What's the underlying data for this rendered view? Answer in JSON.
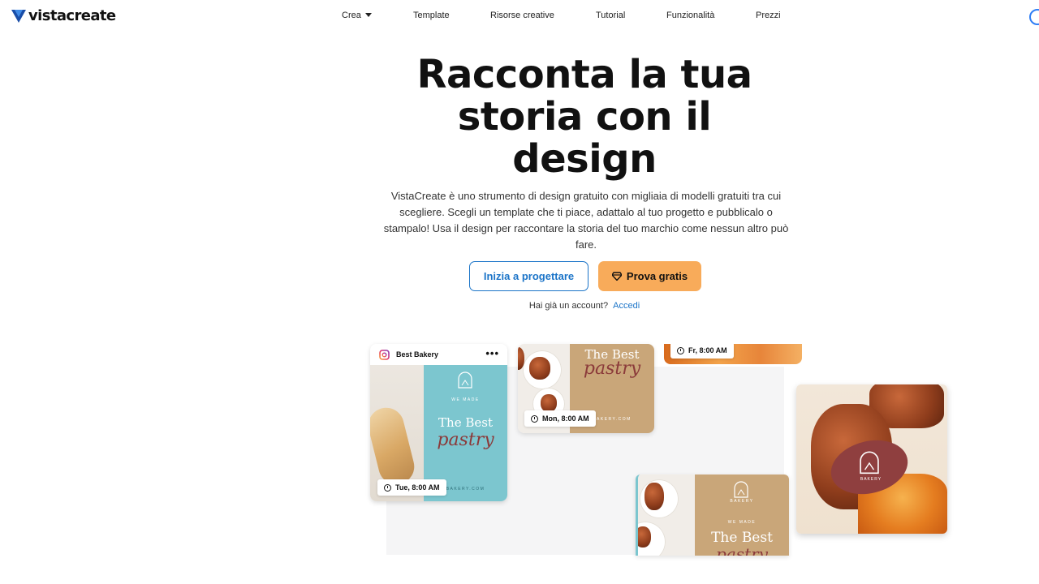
{
  "brand": {
    "name": "vistacreate",
    "colors": {
      "primary": "#1b74c8",
      "cta": "#f8ab5a",
      "logo": "#1a4ea8"
    }
  },
  "nav": {
    "items": [
      {
        "label": "Crea",
        "has_dropdown": true
      },
      {
        "label": "Template"
      },
      {
        "label": "Risorse creative"
      },
      {
        "label": "Tutorial"
      },
      {
        "label": "Funzionalità"
      },
      {
        "label": "Prezzi"
      }
    ]
  },
  "hero": {
    "title_lines": [
      "Racconta la tua",
      "storia con il",
      "design"
    ],
    "description": "VistaCreate è uno strumento di design gratuito con migliaia di modelli gratuiti tra cui scegliere. Scegli un template che ti piace, adattalo al tuo progetto e pubblicalo o stampalo! Usa il design per raccontare la storia del tuo marchio come nessun altro può fare.",
    "primary_button": "Inizia a progettare",
    "secondary_button": "Prova gratis",
    "login_prompt": "Hai già un account?",
    "login_link": "Accedi"
  },
  "showcase": {
    "post_account": "Best Bakery",
    "post_menu": "•••",
    "schedules": [
      "Tue, 8:00 AM",
      "Mon, 8:00 AM",
      "Fr, 8:00 AM"
    ],
    "design_text": {
      "tagline": "WE MADE",
      "headline": "The Best",
      "script": "pastry",
      "brand_mark": "BAKERY",
      "website": "BAKERY.COM"
    }
  }
}
